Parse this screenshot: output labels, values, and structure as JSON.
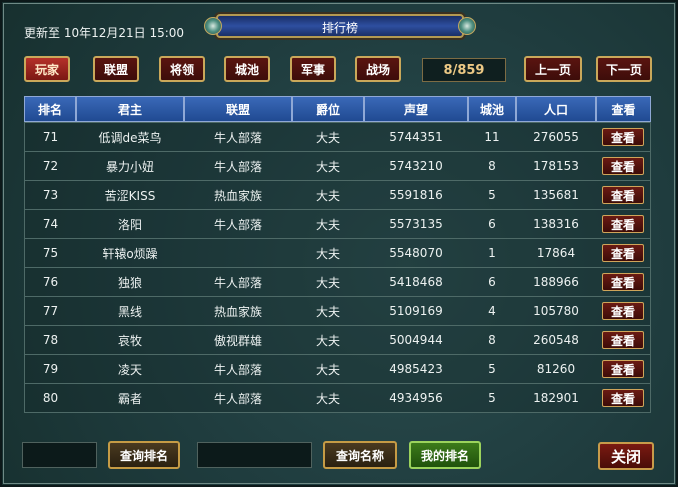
{
  "header": {
    "update_time": "更新至 10年12月21日 15:00",
    "title": "排行榜"
  },
  "categories": [
    {
      "label": "玩家",
      "active": true
    },
    {
      "label": "联盟",
      "active": false
    },
    {
      "label": "将领",
      "active": false
    },
    {
      "label": "城池",
      "active": false
    },
    {
      "label": "军事",
      "active": false
    },
    {
      "label": "战场",
      "active": false
    }
  ],
  "pagination": {
    "indicator": "8/859",
    "prev_label": "上一页",
    "next_label": "下一页"
  },
  "table": {
    "columns": [
      "排名",
      "君主",
      "联盟",
      "爵位",
      "声望",
      "城池",
      "人口",
      "查看"
    ],
    "view_label": "查看",
    "rows": [
      [
        "71",
        "低调de菜鸟",
        "牛人部落",
        "大夫",
        "5744351",
        "11",
        "276055"
      ],
      [
        "72",
        "暴力小妞",
        "牛人部落",
        "大夫",
        "5743210",
        "8",
        "178153"
      ],
      [
        "73",
        "苦涩KISS",
        "热血家族",
        "大夫",
        "5591816",
        "5",
        "135681"
      ],
      [
        "74",
        "洛阳",
        "牛人部落",
        "大夫",
        "5573135",
        "6",
        "138316"
      ],
      [
        "75",
        "轩辕o烦躁",
        "",
        "大夫",
        "5548070",
        "1",
        "17864"
      ],
      [
        "76",
        "独狼",
        "牛人部落",
        "大夫",
        "5418468",
        "6",
        "188966"
      ],
      [
        "77",
        "黑线",
        "热血家族",
        "大夫",
        "5109169",
        "4",
        "105780"
      ],
      [
        "78",
        "哀牧",
        "傲视群雄",
        "大夫",
        "5004944",
        "8",
        "260548"
      ],
      [
        "79",
        "凌天",
        "牛人部落",
        "大夫",
        "4985423",
        "5",
        "81260"
      ],
      [
        "80",
        "霸者",
        "牛人部落",
        "大夫",
        "4934956",
        "5",
        "182901"
      ]
    ]
  },
  "footer": {
    "rank_input_value": "",
    "query_rank_label": "查询排名",
    "name_input_value": "",
    "query_name_label": "查询名称",
    "my_rank_label": "我的排名",
    "close_label": "关闭"
  }
}
